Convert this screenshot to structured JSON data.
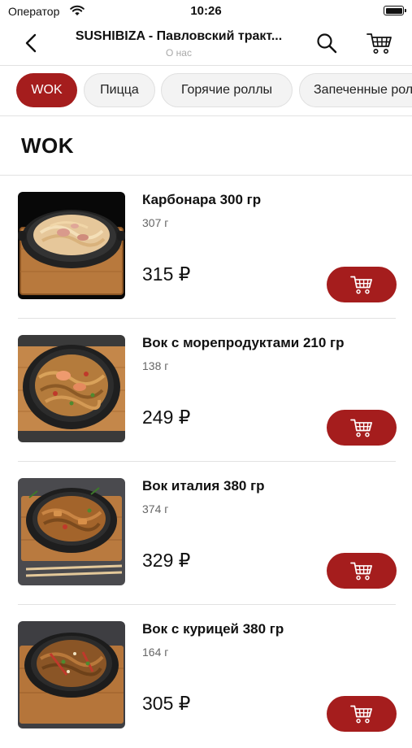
{
  "status": {
    "carrier": "Оператор",
    "time": "10:26",
    "battery": 1.0
  },
  "nav": {
    "title": "SUSHIBIZA - Павловский тракт...",
    "subtitle": "О нас"
  },
  "colors": {
    "accent": "#a51d1d",
    "chip_bg": "#f3f3f3",
    "divider": "#e2e2e2"
  },
  "icons": {
    "back": "chevron-left-icon",
    "search": "search-icon",
    "cart": "cart-icon",
    "add": "add-to-cart-icon"
  },
  "categories": [
    {
      "label": "WOK",
      "active": true
    },
    {
      "label": "Пицца",
      "active": false
    },
    {
      "label": "Горячие  роллы",
      "active": false
    },
    {
      "label": "Запеченные роллы",
      "active": false
    }
  ],
  "section_title": "WOK",
  "items": [
    {
      "name": "Карбонара 300 гр",
      "weight": "307 г",
      "price": "315 ₽"
    },
    {
      "name": "Вок с морепродуктами  210 гр",
      "weight": "138 г",
      "price": "249 ₽"
    },
    {
      "name": "Вок италия 380 гр",
      "weight": "374 г",
      "price": "329 ₽"
    },
    {
      "name": "Вок с курицей 380 гр",
      "weight": "164 г",
      "price": "305 ₽"
    }
  ]
}
